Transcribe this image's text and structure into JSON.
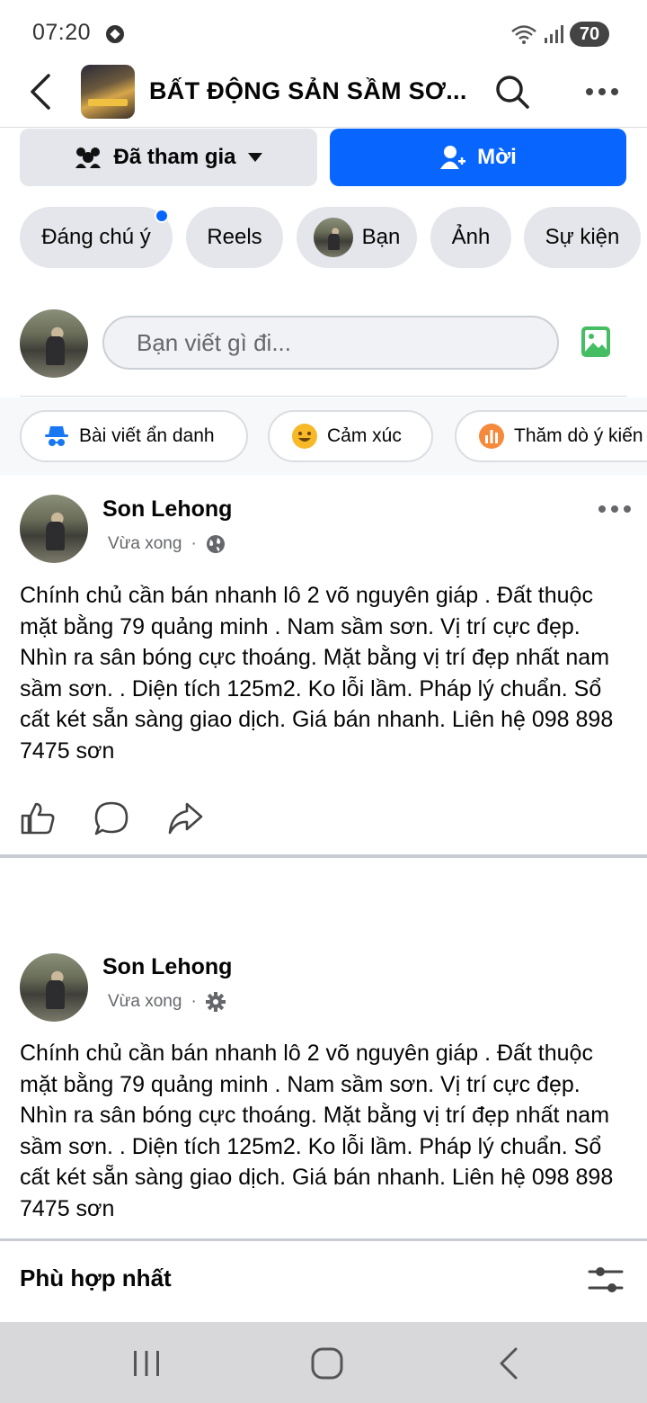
{
  "status_bar": {
    "time": "07:20",
    "battery": "70",
    "icons": [
      "soccer-ball-icon",
      "wifi-icon",
      "signal-icon",
      "battery-icon"
    ]
  },
  "header": {
    "title": "BẤT ĐỘNG SẢN SẦM SƠ...",
    "icons": [
      "back-icon",
      "search-icon",
      "more-icon"
    ]
  },
  "membership": {
    "joined_label": "Đã tham gia",
    "invite_label": "Mời",
    "accent": "#0866ff"
  },
  "chips": [
    {
      "label": "Đáng chú ý",
      "has_dot": true
    },
    {
      "label": "Reels"
    },
    {
      "label": "Bạn",
      "has_avatar": true
    },
    {
      "label": "Ảnh"
    },
    {
      "label": "Sự kiện"
    }
  ],
  "composer": {
    "placeholder": "Bạn viết gì đi..."
  },
  "quick_actions": [
    {
      "label": "Bài viết ẩn danh",
      "icon": "anonymous-icon"
    },
    {
      "label": "Cảm xúc",
      "icon": "emoji-icon"
    },
    {
      "label": "Thăm dò ý kiến",
      "icon": "poll-icon"
    }
  ],
  "posts": [
    {
      "author": "Son Lehong",
      "time": "Vừa xong",
      "privacy_icon": "globe-icon",
      "text": "Chính chủ cần bán nhanh lô 2 võ nguyên giáp . Đất thuộc mặt  bằng 79  quảng minh . Nam sầm sơn. Vị trí cực đẹp. Nhìn ra sân bóng cực thoáng. Mặt bằng vị trí đẹp nhất nam sầm sơn. . Diện tích 125m2. Ko lỗi lầm. Pháp lý chuẩn. Sổ cất két sẵn sàng giao dịch. Giá bán nhanh. Liên hệ 098 898 7475 sơn"
    },
    {
      "author": "Son Lehong",
      "time": "Vừa xong",
      "privacy_icon": "gear-icon",
      "text": "Chính chủ cần bán nhanh lô 2 võ nguyên giáp . Đất thuộc mặt  bằng 79  quảng minh . Nam sầm sơn. Vị trí cực đẹp. Nhìn ra sân bóng cực thoáng. Mặt bằng vị trí đẹp nhất nam sầm sơn. . Diện tích 125m2. Ko lỗi lầm. Pháp lý chuẩn. Sổ cất két sẵn sàng giao dịch. Giá bán nhanh. Liên hệ 098 898 7475 sơn"
    }
  ],
  "sort": {
    "label": "Phù hợp nhất"
  },
  "navbar": {
    "icons": [
      "recent-apps-icon",
      "home-icon",
      "back-nav-icon"
    ]
  }
}
